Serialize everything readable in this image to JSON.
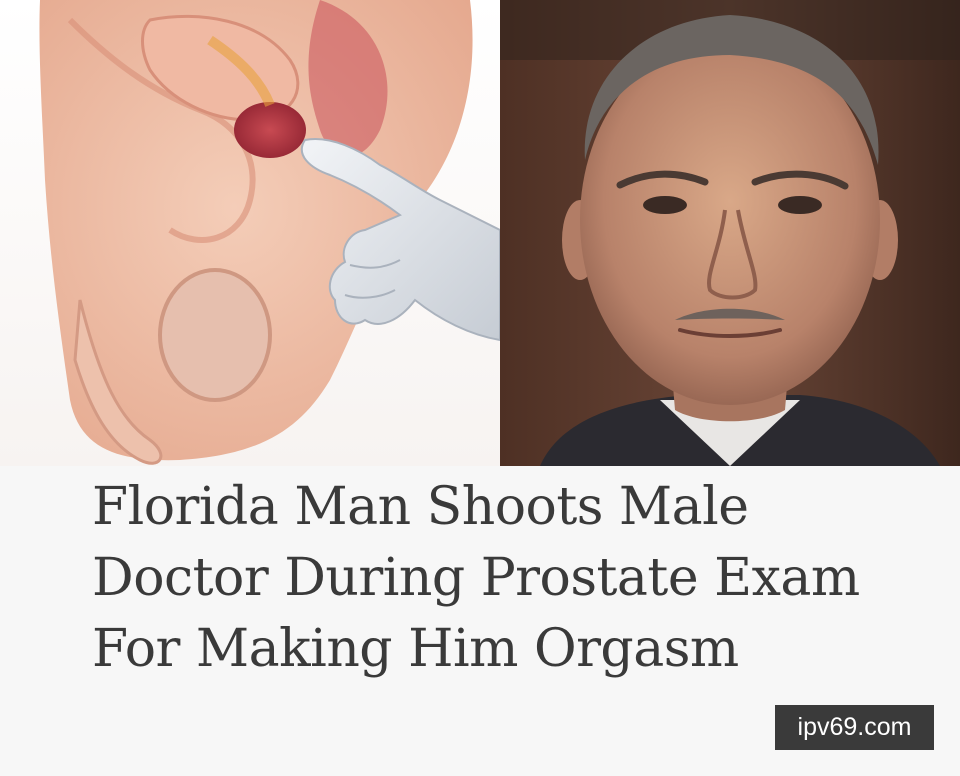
{
  "article": {
    "headline": "Florida Man Shoots Male Doctor During Prostate Exam For Making Him Orgasm"
  },
  "images": {
    "left_illustration": "prostate-exam-illustration",
    "right_photo": "man-portrait-photo"
  },
  "watermark": {
    "text": "ipv69.com"
  },
  "colors": {
    "headline_text": "#3a3a3a",
    "watermark_bg": "#3a3a3a",
    "page_bg": "#f7f7f7"
  }
}
